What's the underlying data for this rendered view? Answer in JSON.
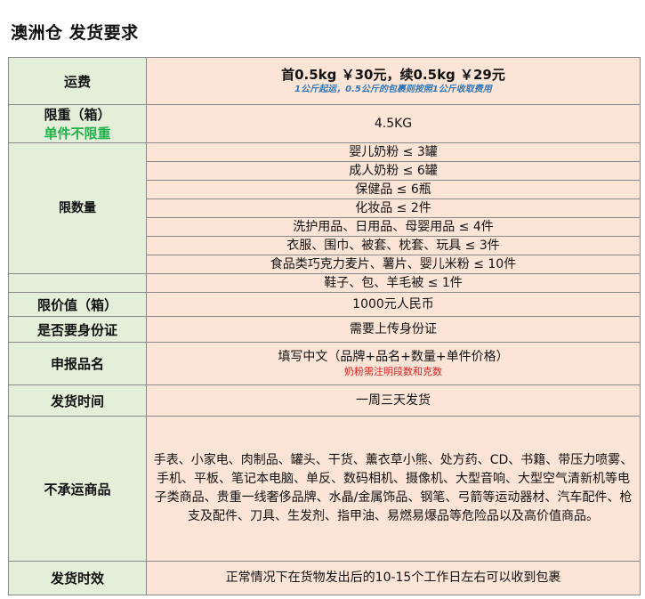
{
  "title": "澳洲仓 发货要求",
  "rows": {
    "fee": {
      "label": "运费",
      "main": "首0.5kg ￥30元，续0.5kg ￥29元",
      "note": "1公斤起运，0.5公斤的包裹则按照1公斤收取费用"
    },
    "weight": {
      "label": "限重（箱）",
      "sublabel": "单件不限重",
      "value": "4.5KG"
    },
    "quantity": {
      "label": "限数量",
      "items": [
        "婴儿奶粉 ≤ 3罐",
        "成人奶粉 ≤ 6罐",
        "保健品 ≤ 6瓶",
        "化妆品 ≤ 2件",
        "洗护用品、日用品、母婴用品 ≤ 4件",
        "衣服、围巾、被套、枕套、玩具 ≤ 3件",
        "食品类巧克力麦片、薯片、婴儿米粉 ≤ 10件",
        "鞋子、包、羊毛被 ≤ 1件"
      ]
    },
    "price_limit": {
      "label": "限价值（箱）",
      "value": "1000元人民币"
    },
    "id_required": {
      "label": "是否要身份证",
      "value": "需要上传身份证"
    },
    "declaration": {
      "label": "申报品名",
      "value": "填写中文（品牌+品名+数量+单件价格）",
      "note": "奶粉需注明段数和克数"
    },
    "ship_time": {
      "label": "发货时间",
      "value": "一周三天发货"
    },
    "not_shipped": {
      "label": "不承运商品",
      "value": "手表、小家电、肉制品、罐头、干货、薰衣草小熊、处方药、CD、书籍、带压力喷雾、手机、平板、笔记本电脑、单反、数码相机、摄像机、大型音响、大型空气清新机等电子类商品、贵重一线奢侈品牌、水晶/金属饰品、钢笔、弓箭等运动器材、汽车配件、枪支及配件、刀具、生发剂、指甲油、易燃易爆品等危险品以及高价值商品。"
    },
    "delivery": {
      "label": "发货时效",
      "value": "正常情况下在货物发出后的10-15个工作日左右可以收到包裹"
    }
  },
  "colors": {
    "label_bg": "#e4efd9",
    "value_bg": "#fce4d6",
    "note_blue": "#2e75b6",
    "note_red": "#e02020",
    "green": "#22b14c"
  }
}
